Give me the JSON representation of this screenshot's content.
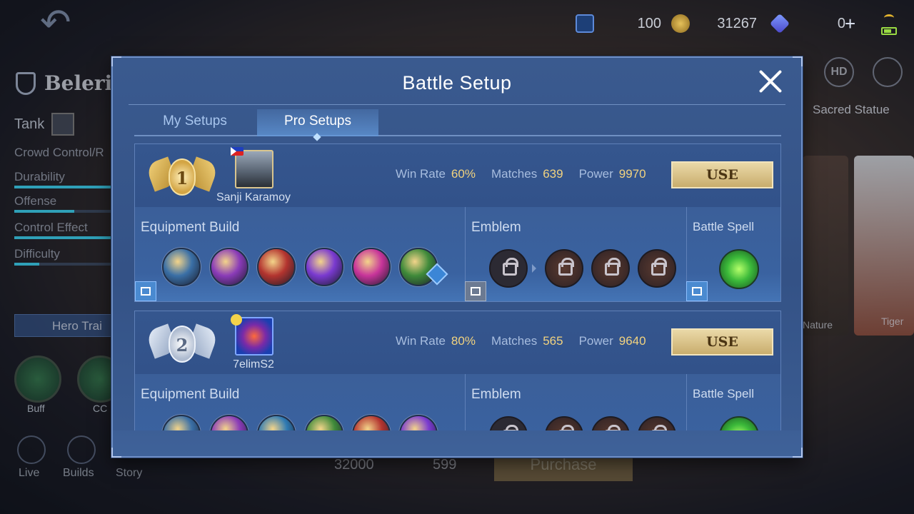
{
  "background": {
    "hero_name": "Beleric",
    "role": "Tank",
    "stats": [
      "Crowd Control/R",
      "Durability",
      "Offense",
      "Control Effect",
      "Difficulty"
    ],
    "hero_trial": "Hero Trai",
    "skill_buttons": [
      "Buff",
      "CC"
    ],
    "bottom_nav": [
      "Live",
      "Builds",
      "Story"
    ],
    "currency": [
      {
        "name": "m-ticket-icon",
        "value": "100"
      },
      {
        "name": "battle-point-icon",
        "value": "31267"
      },
      {
        "name": "diamond-icon",
        "value": "0"
      }
    ],
    "hd_label": "HD",
    "skin_title": "Sacred Statue",
    "skin_cards": [
      "Nature",
      "Tiger"
    ],
    "bottom_costs": [
      "32000",
      "599"
    ],
    "purchase_label": "Purchase"
  },
  "modal": {
    "title": "Battle Setup",
    "tabs": [
      {
        "label": "My Setups",
        "active": false
      },
      {
        "label": "Pro Setups",
        "active": true
      }
    ],
    "section_labels": {
      "equipment": "Equipment Build",
      "emblem": "Emblem",
      "spell": "Battle Spell"
    },
    "stat_labels": {
      "win_rate": "Win Rate",
      "matches": "Matches",
      "power": "Power"
    },
    "use_label": "USE",
    "setups": [
      {
        "rank": "1",
        "rank_tier": "gold",
        "player": "Sanji Karamoy",
        "win_rate": "60%",
        "matches": "639",
        "power": "9970",
        "items": [
          {
            "icon": "warrior-boots-icon",
            "color": "#3a6fa6"
          },
          {
            "icon": "cursed-helmet-icon",
            "color": "#8a3bb8"
          },
          {
            "icon": "dominance-ice-icon",
            "color": "#b3342f"
          },
          {
            "icon": "athenas-shield-icon",
            "color": "#7a3ad0"
          },
          {
            "icon": "antique-cuirass-icon",
            "color": "#c7349a"
          },
          {
            "icon": "guardian-helmet-icon",
            "color": "#3f8a3a"
          }
        ]
      },
      {
        "rank": "2",
        "rank_tier": "silver",
        "player": "7elimS2",
        "win_rate": "80%",
        "matches": "565",
        "power": "9640",
        "items": [
          {
            "icon": "tough-boots-icon",
            "color": "#3a6fa6"
          },
          {
            "icon": "cursed-helmet-icon",
            "color": "#8a3bb8"
          },
          {
            "icon": "thunder-belt-icon",
            "color": "#2f7ab3"
          },
          {
            "icon": "guardian-helmet-icon",
            "color": "#3f8a3a"
          },
          {
            "icon": "dominance-ice-icon",
            "color": "#b3342f"
          },
          {
            "icon": "athenas-shield-icon",
            "color": "#7a3ad0"
          }
        ]
      }
    ]
  }
}
